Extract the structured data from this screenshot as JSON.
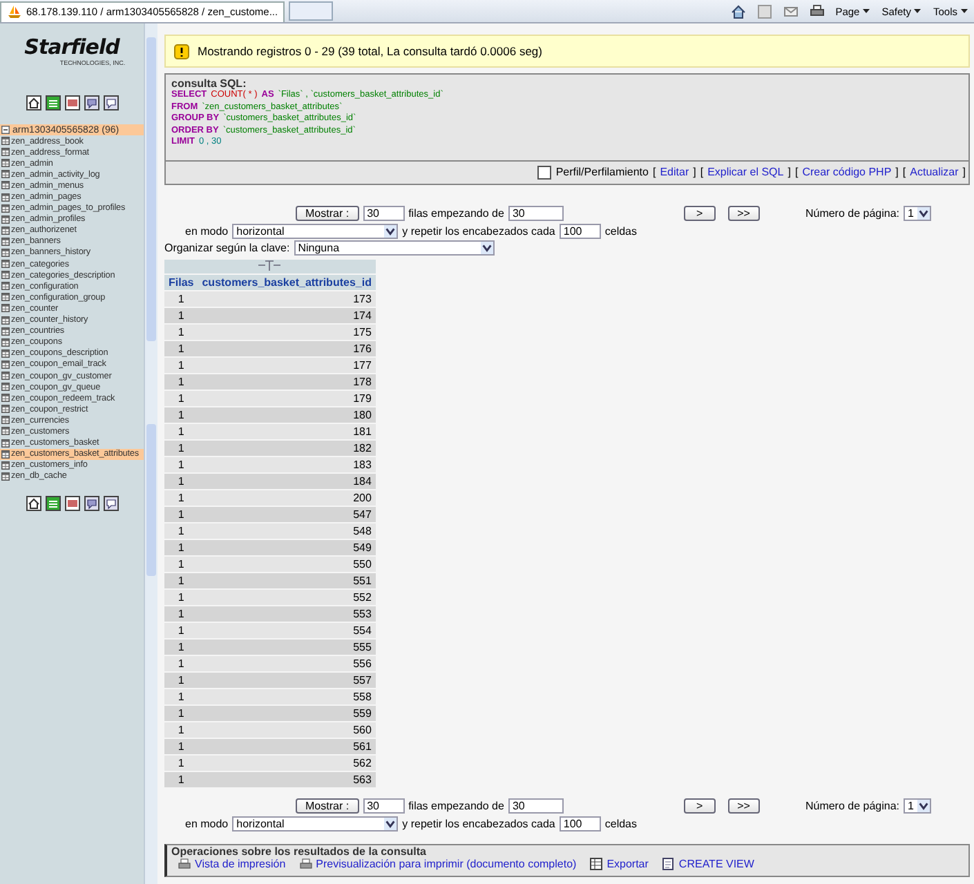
{
  "browser": {
    "tab_title": "68.178.139.110 / arm1303405565828 / zen_custome...",
    "toolbar": [
      "Page",
      "Safety",
      "Tools"
    ]
  },
  "sidebar": {
    "logo": "Starfield",
    "logo_sub": "TECHNOLOGIES, INC.",
    "database": {
      "label": "arm1303405565828 (96)",
      "selected": true
    },
    "tables": [
      {
        "label": "zen_address_book",
        "selected": false
      },
      {
        "label": "zen_address_format",
        "selected": false
      },
      {
        "label": "zen_admin",
        "selected": false
      },
      {
        "label": "zen_admin_activity_log",
        "selected": false
      },
      {
        "label": "zen_admin_menus",
        "selected": false
      },
      {
        "label": "zen_admin_pages",
        "selected": false
      },
      {
        "label": "zen_admin_pages_to_profiles",
        "selected": false
      },
      {
        "label": "zen_admin_profiles",
        "selected": false
      },
      {
        "label": "zen_authorizenet",
        "selected": false
      },
      {
        "label": "zen_banners",
        "selected": false
      },
      {
        "label": "zen_banners_history",
        "selected": false
      },
      {
        "label": "zen_categories",
        "selected": false
      },
      {
        "label": "zen_categories_description",
        "selected": false
      },
      {
        "label": "zen_configuration",
        "selected": false
      },
      {
        "label": "zen_configuration_group",
        "selected": false
      },
      {
        "label": "zen_counter",
        "selected": false
      },
      {
        "label": "zen_counter_history",
        "selected": false
      },
      {
        "label": "zen_countries",
        "selected": false
      },
      {
        "label": "zen_coupons",
        "selected": false
      },
      {
        "label": "zen_coupons_description",
        "selected": false
      },
      {
        "label": "zen_coupon_email_track",
        "selected": false
      },
      {
        "label": "zen_coupon_gv_customer",
        "selected": false
      },
      {
        "label": "zen_coupon_gv_queue",
        "selected": false
      },
      {
        "label": "zen_coupon_redeem_track",
        "selected": false
      },
      {
        "label": "zen_coupon_restrict",
        "selected": false
      },
      {
        "label": "zen_currencies",
        "selected": false
      },
      {
        "label": "zen_customers",
        "selected": false
      },
      {
        "label": "zen_customers_basket",
        "selected": false
      },
      {
        "label": "zen_customers_basket_attributes",
        "selected": true
      },
      {
        "label": "zen_customers_info",
        "selected": false
      },
      {
        "label": "zen_db_cache",
        "selected": false
      }
    ]
  },
  "notice": "Mostrando registros 0 - 29 (39 total, La consulta tardó 0.0006 seg)",
  "sql": {
    "legend": "consulta SQL:",
    "lines": [
      [
        {
          "kind": "keyword",
          "text": "SELECT"
        },
        {
          "kind": "function",
          "text": "COUNT( * )"
        },
        {
          "kind": "keyword",
          "text": "AS"
        },
        {
          "kind": "string",
          "text": "`Filas` , `customers_basket_attributes_id`"
        }
      ],
      [
        {
          "kind": "keyword",
          "text": "FROM"
        },
        {
          "kind": "string",
          "text": "`zen_customers_basket_attributes`"
        }
      ],
      [
        {
          "kind": "keyword",
          "text": "GROUP BY"
        },
        {
          "kind": "string",
          "text": "`customers_basket_attributes_id`"
        }
      ],
      [
        {
          "kind": "keyword",
          "text": "ORDER BY"
        },
        {
          "kind": "string",
          "text": "`customers_basket_attributes_id`"
        }
      ],
      [
        {
          "kind": "keyword",
          "text": "LIMIT"
        },
        {
          "kind": "number",
          "text": "0 , 30"
        }
      ]
    ],
    "profiling": {
      "label": "Perfil/Perfilamiento",
      "checked": false
    },
    "links": [
      {
        "open": "[",
        "label": "Editar",
        "close": "]"
      },
      {
        "open": "[",
        "label": "Explicar el SQL",
        "close": "]"
      },
      {
        "open": "[",
        "label": "Crear código PHP",
        "close": "]"
      },
      {
        "open": "[",
        "label": "Actualizar",
        "close": "]"
      }
    ]
  },
  "navigation": [
    {
      "show_button": "Mostrar :",
      "rows": "30",
      "rows_label": "filas empezando de",
      "start": "30",
      "next": ">",
      "last": ">>",
      "page_label": "Número de página:",
      "page": "1",
      "mode_label": "en modo",
      "mode": "horizontal",
      "repeat_label": "y repetir los encabezados cada",
      "repeat": "100",
      "cells_label": "celdas"
    },
    {
      "show_button": "Mostrar :",
      "rows": "30",
      "rows_label": "filas empezando de",
      "start": "30",
      "next": ">",
      "last": ">>",
      "page_label": "Número de página:",
      "page": "1",
      "mode_label": "en modo",
      "mode": "horizontal",
      "repeat_label": "y repetir los encabezados cada",
      "repeat": "100",
      "cells_label": "celdas"
    }
  ],
  "sort": {
    "label": "Organizar según la clave:",
    "value": "Ninguna"
  },
  "table": {
    "columns": [
      "Filas",
      "customers_basket_attributes_id"
    ],
    "rows": [
      [
        "1",
        "173"
      ],
      [
        "1",
        "174"
      ],
      [
        "1",
        "175"
      ],
      [
        "1",
        "176"
      ],
      [
        "1",
        "177"
      ],
      [
        "1",
        "178"
      ],
      [
        "1",
        "179"
      ],
      [
        "1",
        "180"
      ],
      [
        "1",
        "181"
      ],
      [
        "1",
        "182"
      ],
      [
        "1",
        "183"
      ],
      [
        "1",
        "184"
      ],
      [
        "1",
        "200"
      ],
      [
        "1",
        "547"
      ],
      [
        "1",
        "548"
      ],
      [
        "1",
        "549"
      ],
      [
        "1",
        "550"
      ],
      [
        "1",
        "551"
      ],
      [
        "1",
        "552"
      ],
      [
        "1",
        "553"
      ],
      [
        "1",
        "554"
      ],
      [
        "1",
        "555"
      ],
      [
        "1",
        "556"
      ],
      [
        "1",
        "557"
      ],
      [
        "1",
        "558"
      ],
      [
        "1",
        "559"
      ],
      [
        "1",
        "560"
      ],
      [
        "1",
        "561"
      ],
      [
        "1",
        "562"
      ],
      [
        "1",
        "563"
      ]
    ]
  },
  "operations": {
    "legend": "Operaciones sobre los resultados de la consulta",
    "items": [
      {
        "kind": "print",
        "label": "Vista de impresión"
      },
      {
        "kind": "print",
        "label": "Previsualización para imprimir (documento completo)"
      },
      {
        "kind": "export",
        "label": "Exportar"
      },
      {
        "kind": "view",
        "label": "CREATE VIEW"
      }
    ]
  }
}
